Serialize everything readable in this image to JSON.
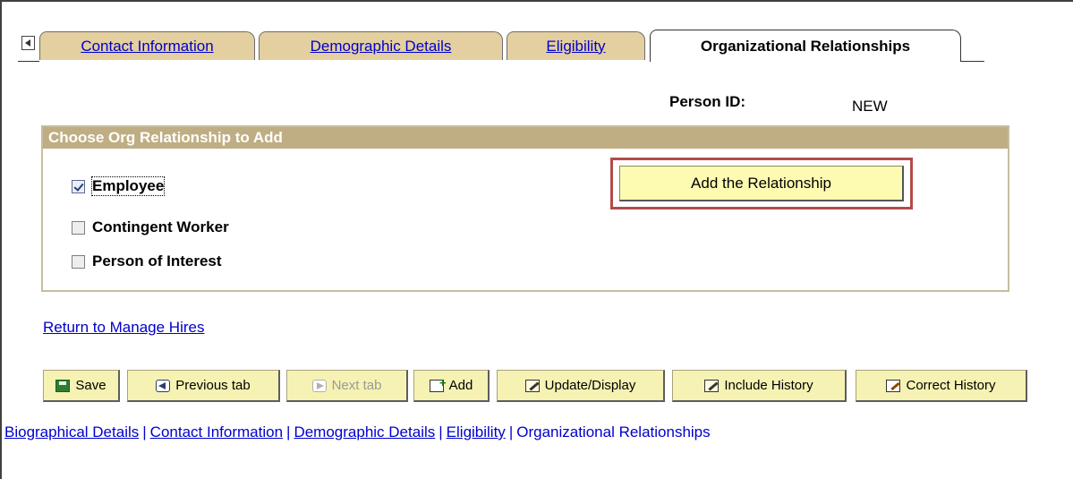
{
  "tabs": {
    "items": [
      {
        "label": "Contact Information"
      },
      {
        "label": "Demographic Details"
      },
      {
        "label": "Eligibility"
      },
      {
        "label": "Organizational Relationships"
      }
    ],
    "active": "Organizational Relationships"
  },
  "person": {
    "id_label": "Person ID:",
    "id_value": "NEW"
  },
  "org_group": {
    "title": "Choose Org Relationship to Add",
    "options": [
      {
        "label": "Employee",
        "checked": true
      },
      {
        "label": "Contingent Worker",
        "checked": false
      },
      {
        "label": "Person of Interest",
        "checked": false
      }
    ],
    "add_button_label": "Add the Relationship"
  },
  "return_link": "Return to Manage Hires",
  "toolbar": {
    "save": "Save",
    "previous_tab": "Previous tab",
    "next_tab": "Next tab",
    "add": "Add",
    "update_display": "Update/Display",
    "include_history": "Include History",
    "correct_history": "Correct History"
  },
  "bottom_links": {
    "biographical": "Biographical Details",
    "contact": "Contact Information",
    "demographic": "Demographic Details",
    "eligibility": "Eligibility",
    "org_relationships": "Organizational Relationships",
    "separator": "|"
  },
  "colors": {
    "tab_bg": "#e3cf9f",
    "group_header": "#bfae83",
    "button_bg": "#f6f2b3",
    "highlight_border": "#b24b4b",
    "link": "#0000cc"
  }
}
